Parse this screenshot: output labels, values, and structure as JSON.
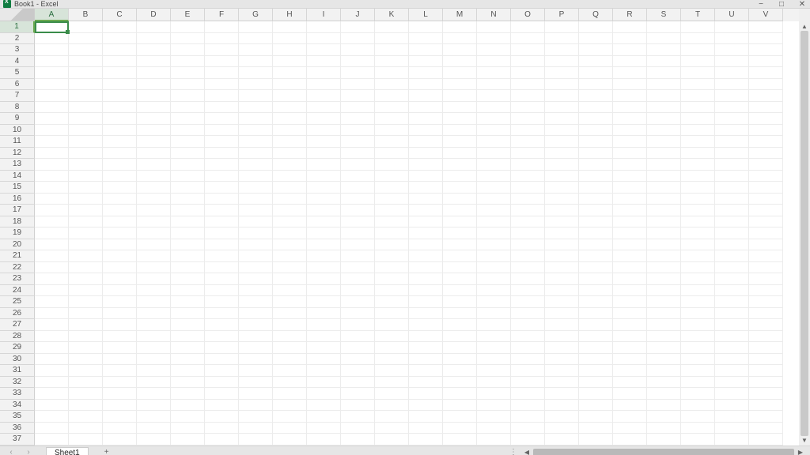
{
  "app": {
    "title": "Book1 - Excel",
    "logo": "excel-icon"
  },
  "window": {
    "minimize": "−",
    "maximize": "□",
    "close": "✕"
  },
  "grid": {
    "columns": [
      "A",
      "B",
      "C",
      "D",
      "E",
      "F",
      "G",
      "H",
      "I",
      "J",
      "K",
      "L",
      "M",
      "N",
      "O",
      "P",
      "Q",
      "R",
      "S",
      "T",
      "U",
      "V"
    ],
    "rows": [
      "1",
      "2",
      "3",
      "4",
      "5",
      "6",
      "7",
      "8",
      "9",
      "10",
      "11",
      "12",
      "13",
      "14",
      "15",
      "16",
      "17",
      "18",
      "19",
      "20",
      "21",
      "22",
      "23",
      "24",
      "25",
      "26",
      "27",
      "28",
      "29",
      "30",
      "31",
      "32",
      "33",
      "34",
      "35",
      "36",
      "37"
    ],
    "selected_cell": "A1",
    "selected_col_index": 0,
    "selected_row_index": 0
  },
  "sheets": {
    "tabs": [
      "Sheet1"
    ],
    "active": "Sheet1",
    "add_label": "+"
  },
  "nav": {
    "prev": "‹",
    "next": "›"
  },
  "scroll": {
    "up": "▲",
    "down": "▼",
    "left": "◀",
    "right": "▶"
  }
}
